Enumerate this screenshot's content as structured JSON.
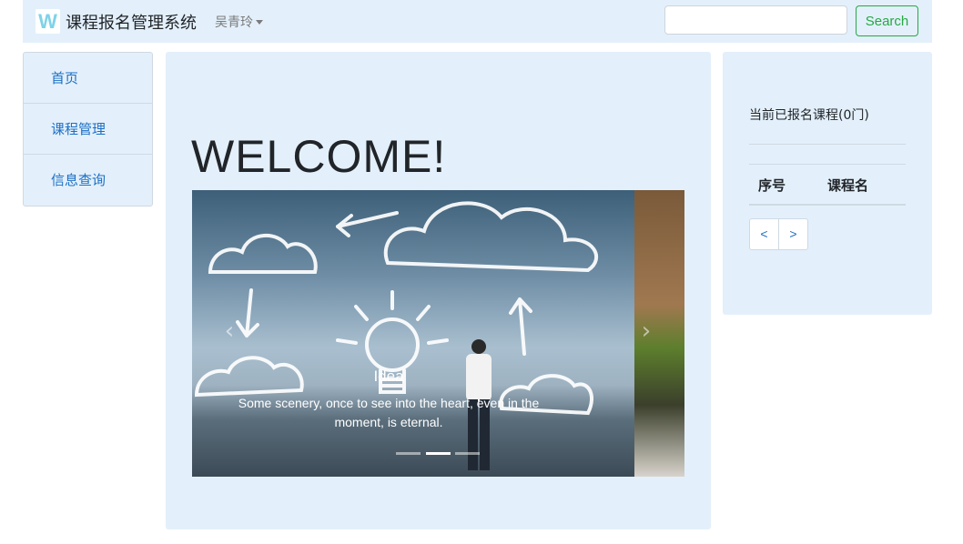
{
  "navbar": {
    "logo_letter": "W",
    "brand_title": "课程报名管理系统",
    "user_name": "吴青玲",
    "search_placeholder": "",
    "search_button": "Search"
  },
  "sidebar": {
    "items": [
      {
        "label": "首页"
      },
      {
        "label": "课程管理"
      },
      {
        "label": "信息查询"
      }
    ]
  },
  "main": {
    "heading": "WELCOME!",
    "carousel": {
      "prev_icon": "‹",
      "next_icon": "›",
      "caption_title": "Idea",
      "caption_text": "Some scenery, once to see into the heart, even in the moment, is eternal.",
      "active_slide": 2,
      "slide_count": 3
    }
  },
  "right": {
    "enrolled_title": "当前已报名课程(0门)",
    "table_headers": [
      "序号",
      "课程名"
    ],
    "pager": {
      "prev": "<",
      "next": ">"
    }
  },
  "colors": {
    "panel_bg": "#e3f0fb",
    "link": "#1d6fc4",
    "success": "#28a745"
  }
}
